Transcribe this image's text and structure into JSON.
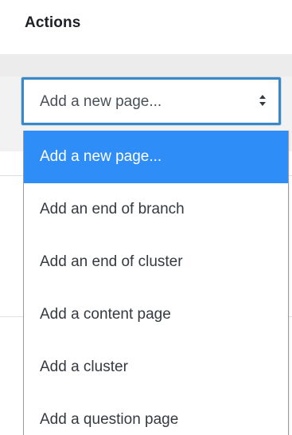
{
  "section": {
    "title": "Actions"
  },
  "select": {
    "value": "Add a new page..."
  },
  "dropdown": {
    "options": [
      {
        "label": "Add a new page...",
        "selected": true
      },
      {
        "label": "Add an end of branch",
        "selected": false
      },
      {
        "label": "Add an end of cluster",
        "selected": false
      },
      {
        "label": "Add a content page",
        "selected": false
      },
      {
        "label": "Add a cluster",
        "selected": false
      },
      {
        "label": "Add a question page",
        "selected": false
      }
    ]
  },
  "colors": {
    "focus_border": "#3a88c6",
    "selected_bg": "#2e8df6",
    "band_bg": "#f2f2f2"
  }
}
